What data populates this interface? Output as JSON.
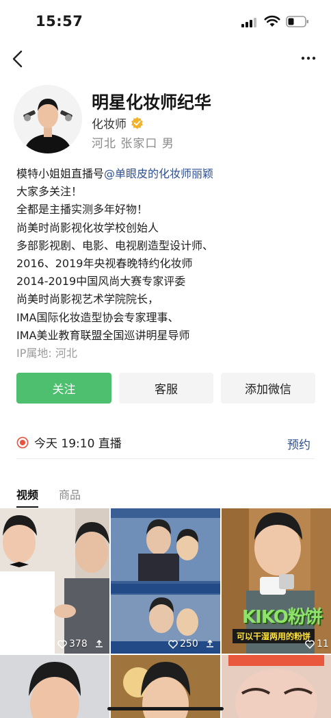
{
  "status": {
    "time": "15:57"
  },
  "profile": {
    "name": "明星化妆师纪华",
    "role": "化妆师",
    "location": "河北 张家口 男"
  },
  "bio": {
    "line1_prefix": "模特小姐姐直播号",
    "line1_mention": "@单眼皮的化妆师丽颖",
    "lines": [
      "大家多关注！",
      "全都是主播实测多年好物！",
      "尚美时尚影视化妆学校创始人",
      "多部影视剧、电影、电视剧造型设计师、",
      "2016、2019年央视春晚特约化妆师",
      "2014-2019中国风尚大赛专家评委",
      "尚美时尚影视艺术学院院长，",
      "IMA国际化妆造型协会专家理事、",
      "IMA美业教育联盟全国巡讲明星导师"
    ],
    "ip": "IP属地: 河北"
  },
  "buttons": {
    "follow": "关注",
    "service": "客服",
    "wechat": "添加微信"
  },
  "live": {
    "text": "今天 19:10 直播",
    "reserve": "预约"
  },
  "tabs": [
    {
      "label": "视频",
      "active": true
    },
    {
      "label": "商品",
      "active": false
    }
  ],
  "videos": [
    {
      "likes": "378"
    },
    {
      "likes": "250"
    },
    {
      "likes": "11",
      "overlay_title": "KIKO粉饼",
      "overlay_subtitle": "可以干湿两用的粉饼"
    }
  ],
  "colors": {
    "follow_green": "#4dbf6e",
    "link_blue": "#2e4f8f",
    "live_red": "#e8533f",
    "verified_gold": "#f2b229"
  },
  "icons": [
    "back-icon",
    "more-icon",
    "verified-icon",
    "live-icon",
    "like-icon",
    "share-icon"
  ]
}
